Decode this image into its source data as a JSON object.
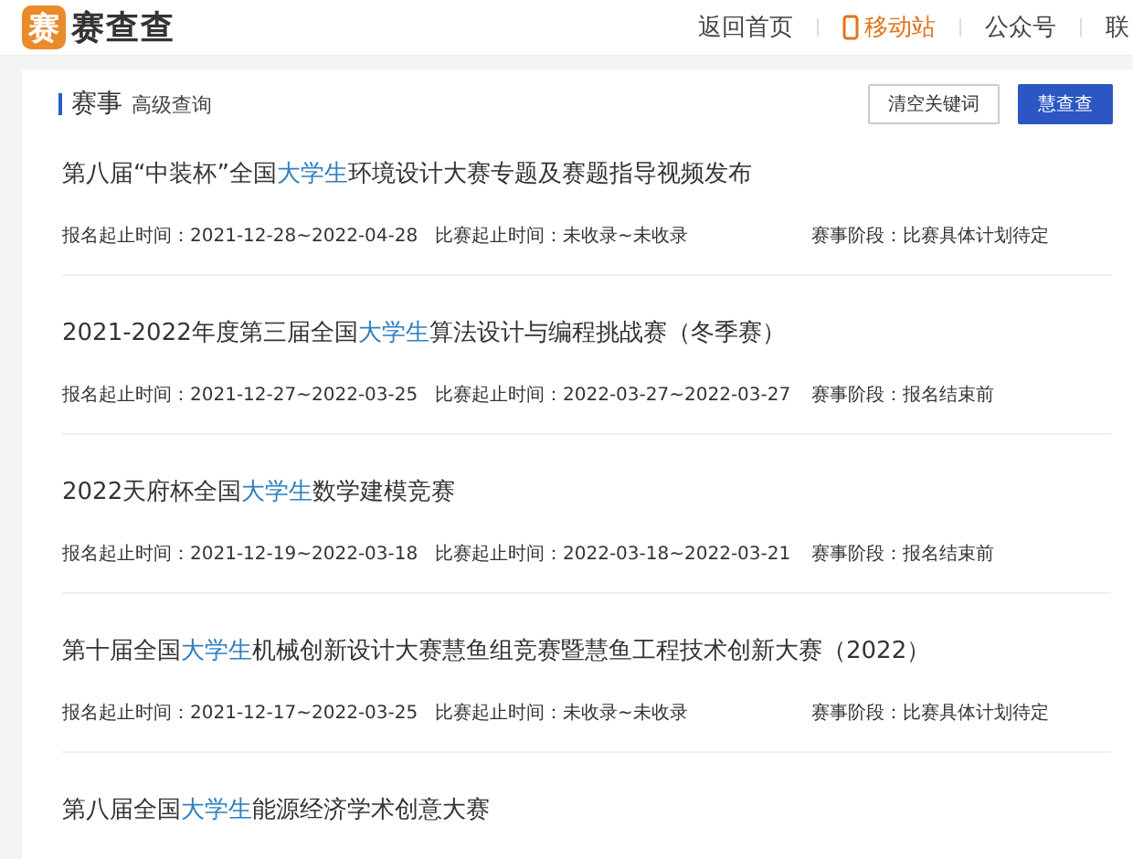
{
  "site": {
    "logo_mark": "赛",
    "name": "赛查查"
  },
  "nav": [
    {
      "label": "返回首页",
      "selected": false,
      "kind": "text"
    },
    {
      "label": "移动站",
      "selected": true,
      "kind": "phone"
    },
    {
      "label": "公众号",
      "selected": false,
      "kind": "text"
    },
    {
      "label": "联",
      "selected": false,
      "kind": "text"
    }
  ],
  "toolbar": {
    "title": "赛事",
    "subtitle": "高级查询",
    "buttons": [
      {
        "label": "清空关键词",
        "kind": "outline"
      },
      {
        "label": "慧查查",
        "kind": "primary"
      }
    ]
  },
  "events": [
    {
      "title_parts": [
        {
          "text": "第八届“中装杯”全国",
          "highlight": false
        },
        {
          "text": "大学生",
          "highlight": true
        },
        {
          "text": "环境设计大赛专题及赛题指导视频发布",
          "highlight": false
        }
      ],
      "signup": "报名起止时间：2021-12-28~2022-04-28",
      "contest": "比赛起止时间：未收录~未收录",
      "stage": "赛事阶段：比赛具体计划待定"
    },
    {
      "title_parts": [
        {
          "text": "2021-2022年度第三届全国",
          "highlight": false
        },
        {
          "text": "大学生",
          "highlight": true
        },
        {
          "text": "算法设计与编程挑战赛（冬季赛）",
          "highlight": false
        }
      ],
      "signup": "报名起止时间：2021-12-27~2022-03-25",
      "contest": "比赛起止时间：2022-03-27~2022-03-27",
      "stage": "赛事阶段：报名结束前"
    },
    {
      "title_parts": [
        {
          "text": "2022天府杯全国",
          "highlight": false
        },
        {
          "text": "大学生",
          "highlight": true
        },
        {
          "text": "数学建模竞赛",
          "highlight": false
        }
      ],
      "signup": "报名起止时间：2021-12-19~2022-03-18",
      "contest": "比赛起止时间：2022-03-18~2022-03-21",
      "stage": "赛事阶段：报名结束前"
    },
    {
      "title_parts": [
        {
          "text": "第十届全国",
          "highlight": false
        },
        {
          "text": "大学生",
          "highlight": true
        },
        {
          "text": "机械创新设计大赛慧鱼组竞赛暨慧鱼工程技术创新大赛（2022）",
          "highlight": false
        }
      ],
      "signup": "报名起止时间：2021-12-17~2022-03-25",
      "contest": "比赛起止时间：未收录~未收录",
      "stage": "赛事阶段：比赛具体计划待定"
    },
    {
      "title_parts": [
        {
          "text": "第八届全国",
          "highlight": false
        },
        {
          "text": "大学生",
          "highlight": true
        },
        {
          "text": "能源经济学术创意大赛",
          "highlight": false
        }
      ]
    }
  ]
}
